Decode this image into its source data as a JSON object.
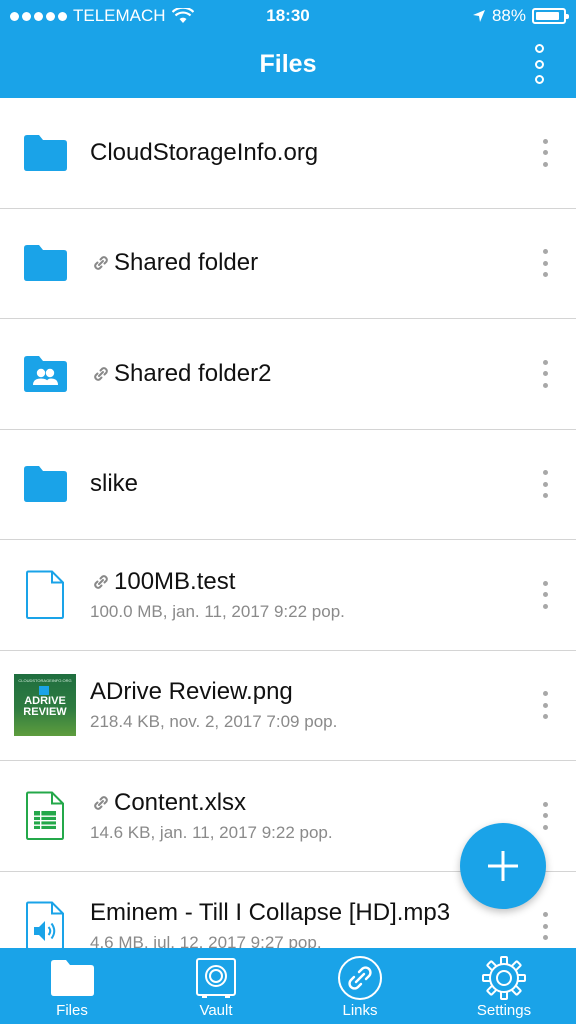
{
  "status_bar": {
    "carrier": "TELEMACH",
    "time": "18:30",
    "battery": "88%",
    "battery_level": 0.88
  },
  "header": {
    "title": "Files"
  },
  "colors": {
    "accent": "#1aa3e8",
    "divider": "#d4d4d4",
    "subtext": "#8a8a8a",
    "spreadsheet_green": "#24a84a"
  },
  "files": [
    {
      "name": "CloudStorageInfo.org",
      "kind": "folder",
      "shared": false,
      "details": ""
    },
    {
      "name": "Shared folder",
      "kind": "folder",
      "shared": true,
      "details": ""
    },
    {
      "name": "Shared folder2",
      "kind": "shared-folder",
      "shared": true,
      "details": ""
    },
    {
      "name": "slike",
      "kind": "folder",
      "shared": false,
      "details": ""
    },
    {
      "name": "100MB.test",
      "kind": "file",
      "shared": true,
      "details": "100.0 MB, jan. 11, 2017 9:22 pop."
    },
    {
      "name": "ADrive Review.png",
      "kind": "image",
      "shared": false,
      "details": "218.4 KB, nov. 2, 2017 7:09 pop."
    },
    {
      "name": "Content.xlsx",
      "kind": "spreadsheet",
      "shared": true,
      "details": "14.6 KB, jan. 11, 2017 9:22 pop."
    },
    {
      "name": "Eminem - Till I Collapse [HD].mp3",
      "kind": "audio",
      "shared": false,
      "details": "4.6 MB, jul. 12, 2017 9:27 pop."
    }
  ],
  "thumbnail": {
    "top_text": "CLOUDSTORAGEINFO.ORG",
    "line1": "ADRIVE",
    "line2": "REVIEW"
  },
  "fab": {
    "icon": "plus-icon"
  },
  "tabs": [
    {
      "label": "Files",
      "icon": "folder-icon",
      "active": true
    },
    {
      "label": "Vault",
      "icon": "vault-icon",
      "active": false
    },
    {
      "label": "Links",
      "icon": "link-icon",
      "active": false
    },
    {
      "label": "Settings",
      "icon": "gear-icon",
      "active": false
    }
  ]
}
